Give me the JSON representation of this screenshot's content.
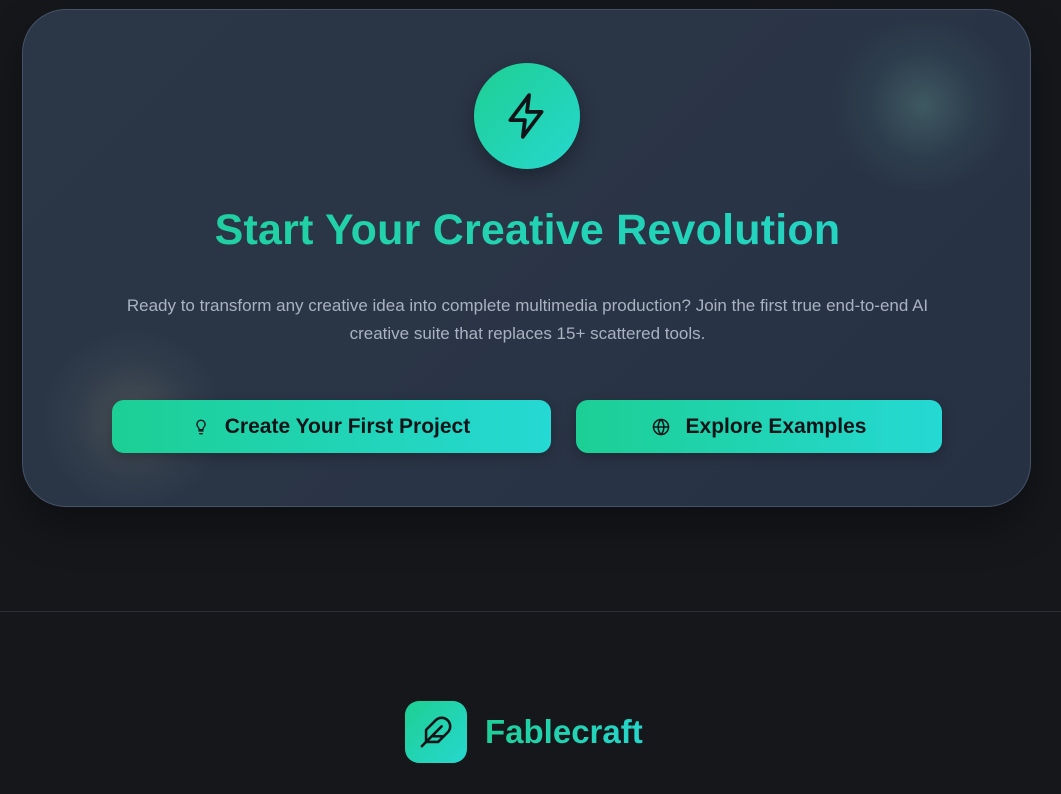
{
  "cta": {
    "icon": "lightning-bolt-icon",
    "title": "Start Your Creative Revolution",
    "description": "Ready to transform any creative idea into complete multimedia production? Join the first true end-to-end AI creative suite that replaces 15+ scattered tools.",
    "primary_button": {
      "label": "Create Your First Project",
      "icon": "lightbulb-icon"
    },
    "secondary_button": {
      "label": "Explore Examples",
      "icon": "globe-icon"
    }
  },
  "footer": {
    "brand_icon": "feather-icon",
    "brand_name": "Fablecraft"
  },
  "colors": {
    "page_background": "#15171b",
    "card_background": "#2b3647",
    "accent_start": "#1ecf92",
    "accent_end": "#26d8cf",
    "body_text": "#a9b2c0",
    "button_text": "#101418"
  }
}
